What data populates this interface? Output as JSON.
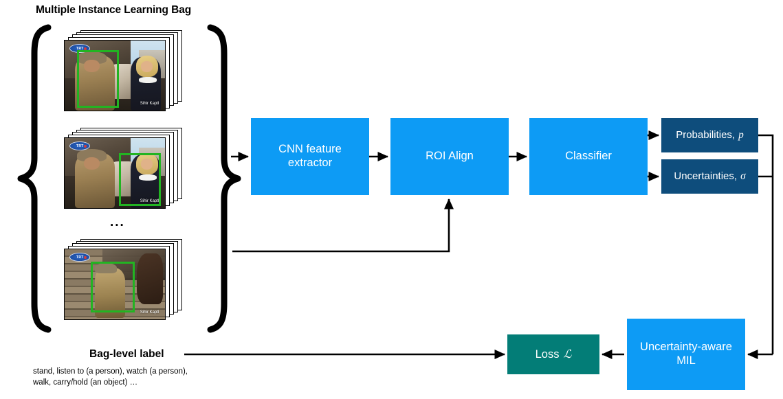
{
  "diagram": {
    "title": "Multiple Instance Learning Bag",
    "bag": {
      "ellipsis": "...",
      "frames": [
        {
          "name": "frame-1",
          "channel_logo": "TRT",
          "watermark": "Sihir Kaptl",
          "bbox_target": "man-in-hat"
        },
        {
          "name": "frame-2",
          "channel_logo": "TRT",
          "watermark": "Sihir Kaptl",
          "bbox_target": "woman-blonde"
        },
        {
          "name": "frame-3",
          "channel_logo": "TRT",
          "watermark": "Sihir Kaptl",
          "bbox_target": "person-walking"
        }
      ]
    },
    "boxes": {
      "cnn": "CNN feature\nextractor",
      "cnn_line1": "CNN feature",
      "cnn_line2": "extractor",
      "roi_align": "ROI Align",
      "classifier": "Classifier",
      "probabilities_text": "Probabilities,",
      "probabilities_symbol": "p",
      "uncertainties_text": "Uncertainties,",
      "uncertainties_symbol": "σ",
      "mil_line1": "Uncertainty-aware",
      "mil_line2": "MIL",
      "loss_text": "Loss",
      "loss_symbol": "ℒ"
    },
    "labels": {
      "bag_level_label": "Bag-level label",
      "bag_level_classes": "stand, listen to (a person), watch (a person),\nwalk, carry/hold (an object) …"
    },
    "colors": {
      "blue": "#0d9bf5",
      "navy": "#0e4d7c",
      "teal": "#037d77",
      "bbox_green": "#22b422",
      "arrow": "#000000",
      "background": "#ffffff"
    }
  }
}
